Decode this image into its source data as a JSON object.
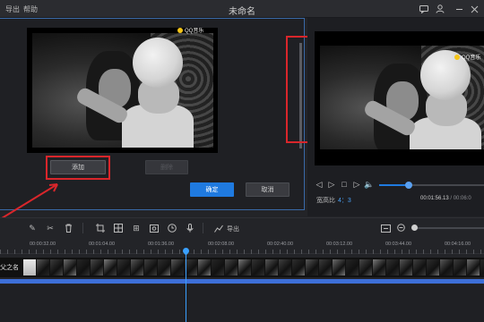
{
  "menu": {
    "export": "导出",
    "help": "帮助"
  },
  "window": {
    "title": "未命名"
  },
  "titlebar_icons": [
    "comment-icon",
    "user-icon",
    "minimize-icon",
    "close-icon"
  ],
  "watermark": {
    "text": "QQ音乐"
  },
  "dialog": {
    "add_label": "添加",
    "disabled_label": "删除",
    "ok_label": "确定",
    "cancel_label": "取消"
  },
  "preview": {
    "aspect_label": "宽高比",
    "aspect_value": "4：3",
    "current_time": "00:01:56.13",
    "total_time": "/ 00:06:0",
    "progress_percent": 28
  },
  "toolbar": {
    "export_label": "导出"
  },
  "timeline": {
    "ticks": [
      "00:00:32.00",
      "00:01:04.00",
      "00:01:36.00",
      "00:02:08.00",
      "00:02:40.00",
      "00:03:12.00",
      "00:03:44.00",
      "00:04:16.00"
    ],
    "track_title": "父之名"
  },
  "colors": {
    "accent": "#1f7ae0",
    "highlight_red": "#d9262b",
    "audio_track": "#3d6fd8"
  }
}
